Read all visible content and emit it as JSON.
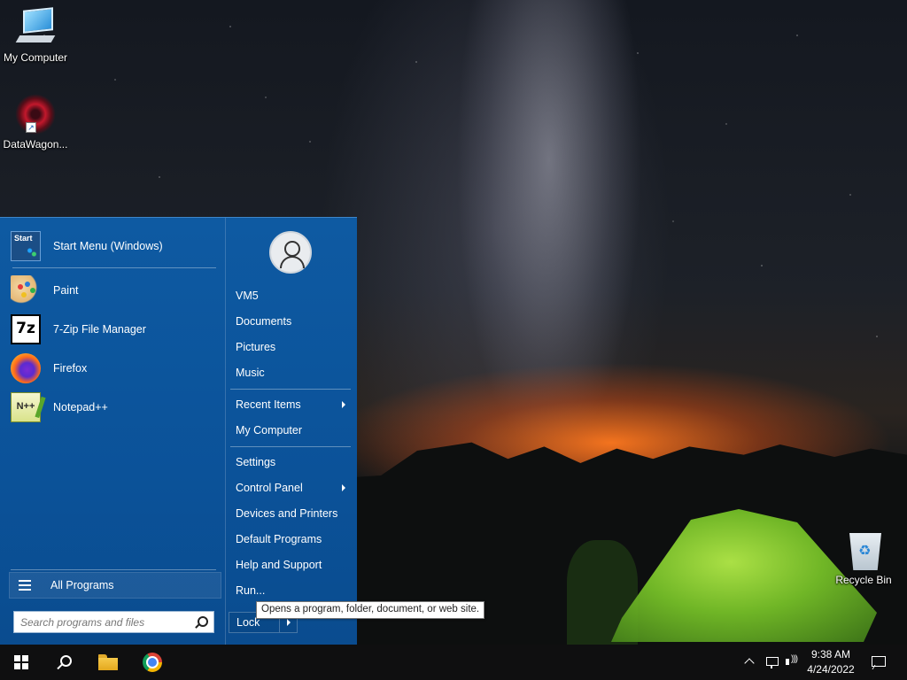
{
  "desktop": {
    "icons": [
      {
        "label": "My Computer"
      },
      {
        "label": "DataWagon..."
      },
      {
        "label": "Recycle Bin"
      }
    ]
  },
  "start_menu": {
    "pinned": [
      {
        "label": "Start Menu (Windows)",
        "icon": "start-menu-icon"
      },
      {
        "label": "Paint",
        "icon": "paint-icon"
      },
      {
        "label": "7-Zip File Manager",
        "icon": "7zip-icon"
      },
      {
        "label": "Firefox",
        "icon": "firefox-icon"
      },
      {
        "label": "Notepad++",
        "icon": "notepad-plus-plus-icon"
      }
    ],
    "startmenu_icon_text": "Start",
    "sevenzip_icon_text": "7z",
    "notepad_icon_text": "N++",
    "all_programs": "All Programs",
    "search_placeholder": "Search programs and files",
    "right": [
      {
        "label": "VM5"
      },
      {
        "label": "Documents"
      },
      {
        "label": "Pictures"
      },
      {
        "label": "Music"
      },
      {
        "label": "Recent Items",
        "submenu": true
      },
      {
        "label": "My Computer"
      },
      {
        "label": "Settings"
      },
      {
        "label": "Control Panel",
        "submenu": true
      },
      {
        "label": "Devices and Printers"
      },
      {
        "label": "Default Programs"
      },
      {
        "label": "Help and Support"
      },
      {
        "label": "Run..."
      }
    ],
    "lock": "Lock",
    "tooltip": "Opens a program, folder, document, or web site."
  },
  "taskbar": {
    "apps": [
      "start-icon",
      "search-icon",
      "file-explorer-icon",
      "chrome-icon"
    ],
    "time": "9:38 AM",
    "date": "4/24/2022"
  },
  "colors": {
    "menu_bg": "#0b5299",
    "taskbar_bg": "#0f0f10"
  }
}
